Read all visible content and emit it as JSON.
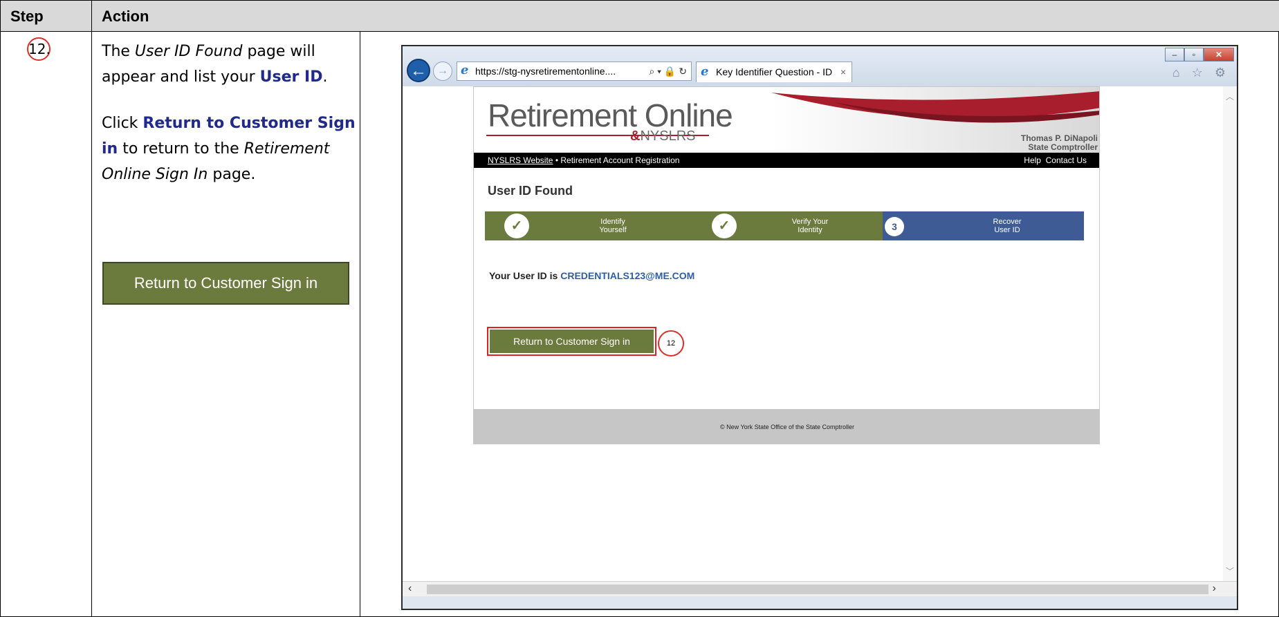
{
  "table": {
    "header_step": "Step",
    "header_action": "Action",
    "step_number": "12.",
    "instructions": {
      "p1_a": "The ",
      "p1_em": "User ID Found",
      "p1_b": " page will appear and list your ",
      "p1_kw": "User ID",
      "p1_c": ".",
      "p2_a": "Click ",
      "p2_kw": "Return to Customer Sign in",
      "p2_b": " to return to the ",
      "p2_em": "Retirement Online Sign In",
      "p2_c": " page."
    },
    "button_label": "Return to Customer Sign in"
  },
  "browser": {
    "address": "https://stg-nysretirementonline....",
    "address_tools": "⌕ ▾ 🔒 ↻",
    "tab_title": "Key Identifier Question - ID",
    "tab_close": "×",
    "window_buttons": [
      "–",
      "▫",
      "✕"
    ],
    "right_icons": "⌂ ☆ ⚙"
  },
  "site": {
    "logo": "Retirement Online",
    "logo_sub": "NYSLRS",
    "comptroller_name": "Thomas P. DiNapoli",
    "comptroller_title": "State Comptroller",
    "nav": {
      "website_link": "NYSLRS Website",
      "separator": " • ",
      "registration": "Retirement Account Registration",
      "help": "Help",
      "contact": "Contact Us"
    },
    "page_title": "User ID Found",
    "steps": [
      {
        "label_line1": "Identify",
        "label_line2": "Yourself",
        "marker": "✓"
      },
      {
        "label_line1": "Verify Your",
        "label_line2": "Identity",
        "marker": "✓"
      },
      {
        "label_line1": "Recover",
        "label_line2": "User ID",
        "marker": "3"
      }
    ],
    "userid_label": "Your User ID is ",
    "userid_value": "CREDENTIALS123@ME.COM",
    "button_label": "Return to Customer Sign in",
    "callout": "12",
    "footer": "© New York State Office of the State Comptroller"
  },
  "colors": {
    "button_green": "#6b7b3d",
    "progress_blue": "#3e5b96",
    "keyword_blue": "#1f2a8a",
    "callout_red": "#d9302a",
    "header_gray": "#d9d9d9"
  }
}
